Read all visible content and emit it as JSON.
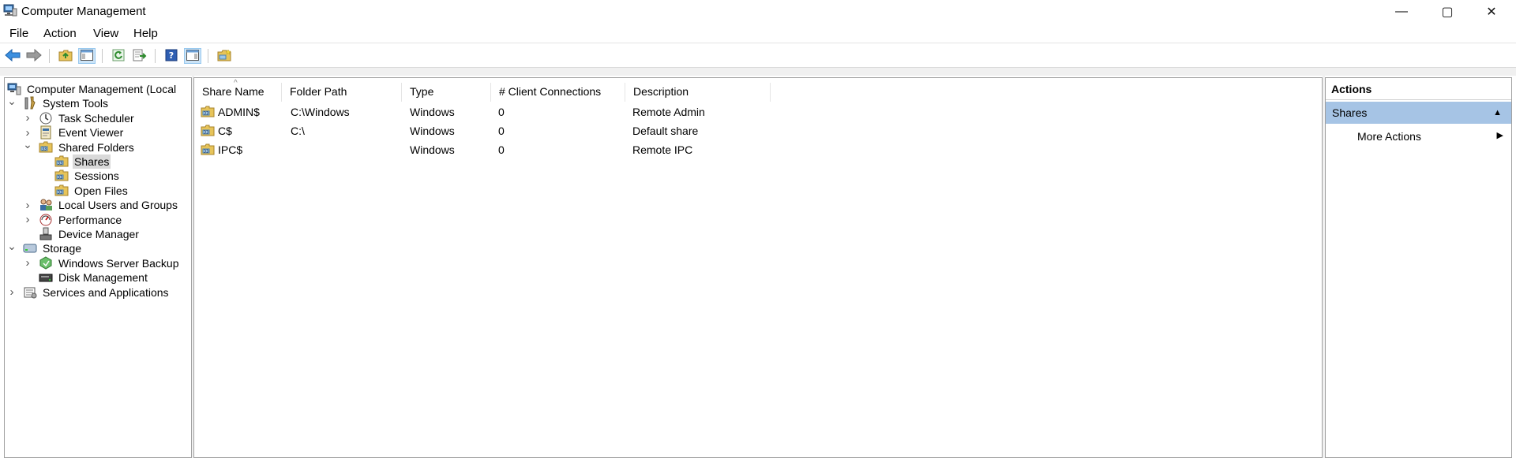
{
  "window": {
    "title": "Computer Management",
    "minimize_glyph": "—",
    "maximize_glyph": "▢",
    "close_glyph": "✕"
  },
  "menu": [
    "File",
    "Action",
    "View",
    "Help"
  ],
  "toolbar": {
    "icons": [
      "back-arrow-icon",
      "forward-arrow-icon",
      "up-folder-icon",
      "show-hide-tree-icon",
      "refresh-icon",
      "export-list-icon",
      "help-icon",
      "show-hide-action-pane-icon",
      "new-share-icon"
    ]
  },
  "tree": {
    "items": [
      {
        "label": "Computer Management (Local",
        "icon": "computer-management-icon",
        "depth": 0,
        "toggle": ""
      },
      {
        "label": "System Tools",
        "icon": "system-tools-icon",
        "depth": 1,
        "toggle": "expanded"
      },
      {
        "label": "Task Scheduler",
        "icon": "task-scheduler-icon",
        "depth": 2,
        "toggle": "collapsed"
      },
      {
        "label": "Event Viewer",
        "icon": "event-viewer-icon",
        "depth": 2,
        "toggle": "collapsed"
      },
      {
        "label": "Shared Folders",
        "icon": "shared-folders-icon",
        "depth": 2,
        "toggle": "expanded"
      },
      {
        "label": "Shares",
        "icon": "shares-icon",
        "depth": 3,
        "toggle": "",
        "selected": true
      },
      {
        "label": "Sessions",
        "icon": "sessions-icon",
        "depth": 3,
        "toggle": ""
      },
      {
        "label": "Open Files",
        "icon": "open-files-icon",
        "depth": 3,
        "toggle": ""
      },
      {
        "label": "Local Users and Groups",
        "icon": "local-users-groups-icon",
        "depth": 2,
        "toggle": "collapsed"
      },
      {
        "label": "Performance",
        "icon": "performance-icon",
        "depth": 2,
        "toggle": "collapsed"
      },
      {
        "label": "Device Manager",
        "icon": "device-manager-icon",
        "depth": 2,
        "toggle": ""
      },
      {
        "label": "Storage",
        "icon": "storage-icon",
        "depth": 1,
        "toggle": "expanded"
      },
      {
        "label": "Windows Server Backup",
        "icon": "windows-server-backup-icon",
        "depth": 2,
        "toggle": "collapsed"
      },
      {
        "label": "Disk Management",
        "icon": "disk-management-icon",
        "depth": 2,
        "toggle": ""
      },
      {
        "label": "Services and Applications",
        "icon": "services-applications-icon",
        "depth": 1,
        "toggle": "collapsed"
      }
    ]
  },
  "list": {
    "columns": [
      "Share Name",
      "Folder Path",
      "Type",
      "# Client Connections",
      "Description"
    ],
    "rows": [
      {
        "share_name": "ADMIN$",
        "folder_path": "C:\\Windows",
        "type": "Windows",
        "client_connections": "0",
        "description": "Remote Admin"
      },
      {
        "share_name": "C$",
        "folder_path": "C:\\",
        "type": "Windows",
        "client_connections": "0",
        "description": "Default share"
      },
      {
        "share_name": "IPC$",
        "folder_path": "",
        "type": "Windows",
        "client_connections": "0",
        "description": "Remote IPC"
      }
    ]
  },
  "actions": {
    "title": "Actions",
    "section": "Shares",
    "items": [
      "More Actions"
    ]
  },
  "colors": {
    "selection": "#d9d9d9",
    "actions_header": "#a6c4e5",
    "accent": "#1e78d7"
  }
}
